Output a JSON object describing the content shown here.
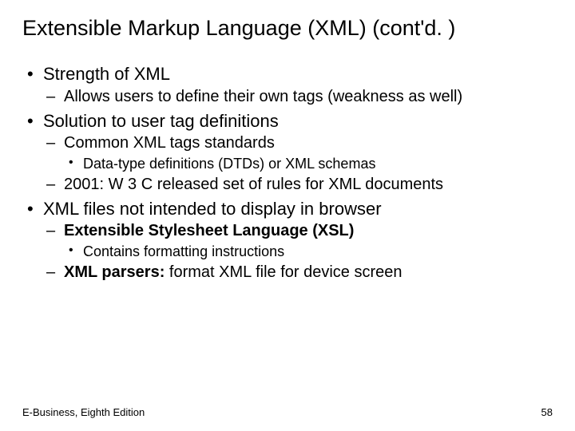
{
  "title": "Extensible Markup Language (XML) (cont'd. )",
  "bullets": {
    "b1": "Strength of XML",
    "b1_1": "Allows users to define their own tags (weakness as well)",
    "b2": "Solution to user tag definitions",
    "b2_1": "Common XML tags standards",
    "b2_1_1": "Data-type definitions (DTDs) or XML schemas",
    "b2_2": "2001: W 3 C released set of rules for XML documents",
    "b3": "XML files not intended to display in browser",
    "b3_1": "Extensible Stylesheet Language (XSL)",
    "b3_1_1": "Contains formatting instructions",
    "b3_2a": "XML parsers:",
    "b3_2b": " format XML file for device screen"
  },
  "footer": {
    "left": "E-Business, Eighth Edition",
    "right": "58"
  }
}
